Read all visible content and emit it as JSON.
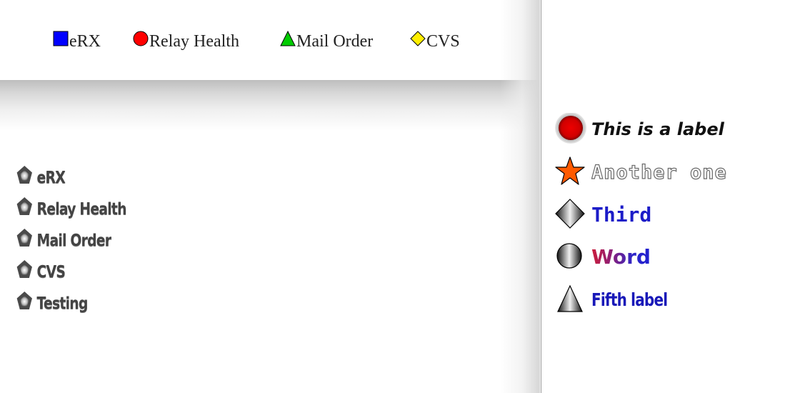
{
  "legend_top": {
    "items": [
      {
        "label": "eRX",
        "icon": "square-icon",
        "color": "#0000ff"
      },
      {
        "label": "Relay Health",
        "icon": "circle-icon",
        "color": "#ff0000"
      },
      {
        "label": "Mail Order",
        "icon": "triangle-icon",
        "color": "#00cc00"
      },
      {
        "label": "CVS",
        "icon": "diamond-icon",
        "color": "#ffee00"
      }
    ]
  },
  "legend_left": {
    "icon": "pentagon-icon",
    "items": [
      "eRX",
      "Relay Health",
      "Mail Order",
      "CVS",
      "Testing"
    ]
  },
  "label_panel": {
    "items": [
      {
        "label": "This is a label",
        "icon": "red-circle-icon",
        "color": "#ff0000"
      },
      {
        "label": "Another one",
        "icon": "star-icon",
        "color": "#ff5a00"
      },
      {
        "label": "Third",
        "icon": "diamond-icon",
        "color": "#1c1cc8"
      },
      {
        "label": "Word",
        "icon": "half-circle-icon",
        "color": "#cc1d3a"
      },
      {
        "label": "Fifth label",
        "icon": "triangle-icon",
        "color": "#1818b8"
      }
    ]
  }
}
